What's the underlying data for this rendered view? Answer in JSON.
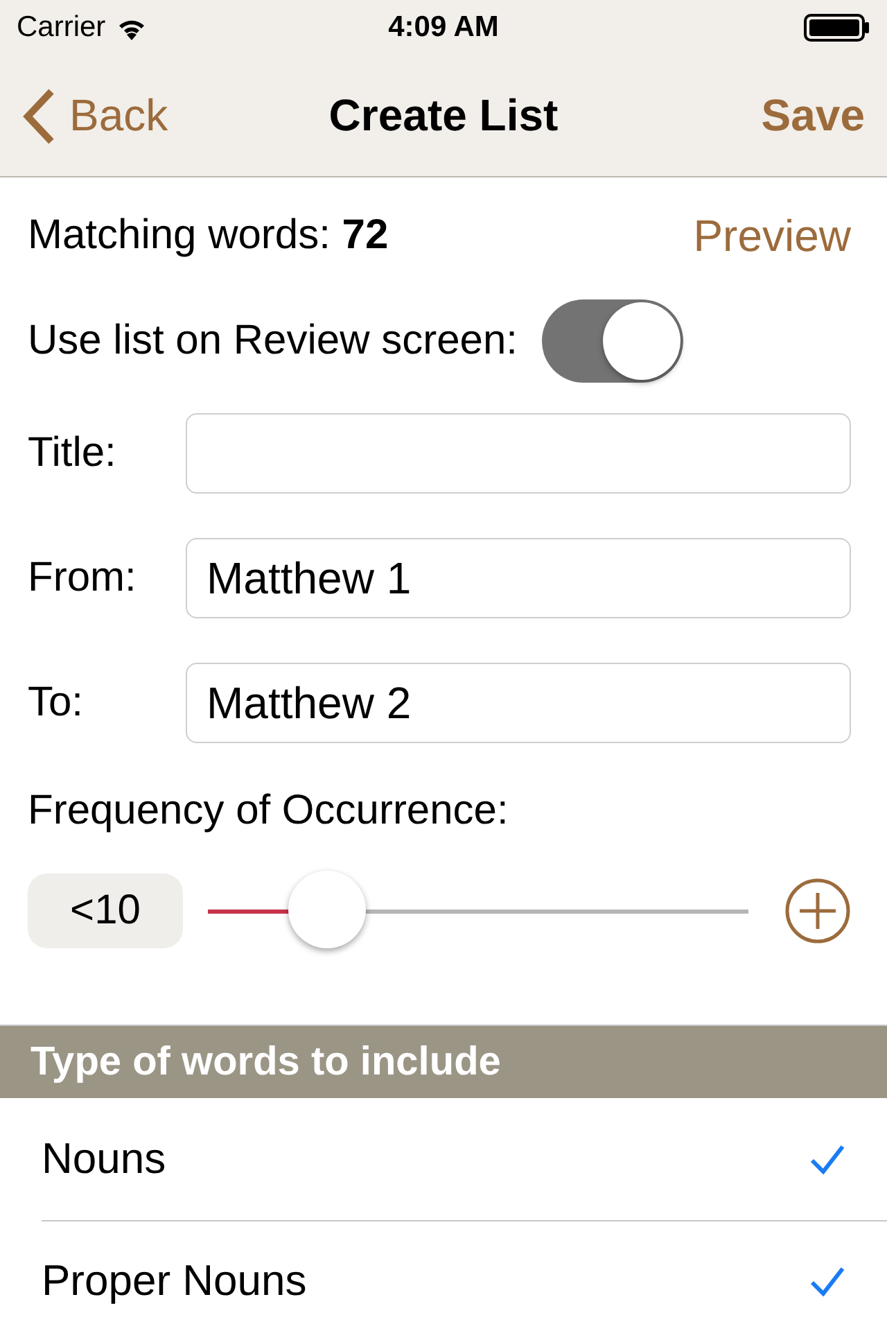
{
  "status_bar": {
    "carrier": "Carrier",
    "time": "4:09 AM"
  },
  "nav": {
    "back": "Back",
    "title": "Create List",
    "save": "Save"
  },
  "matching": {
    "text": "Matching words: **72**",
    "preview": "Preview"
  },
  "review_toggle": {
    "label": "Use list on Review screen:",
    "on": true
  },
  "fields": [
    {
      "label": "Title:"
    },
    {
      "label": "From:",
      "value": "Matthew 1"
    },
    {
      "label": "To:",
      "value": "Matthew 2"
    }
  ],
  "frequency": {
    "label": "Frequency of Occurrence:",
    "reading": "<10",
    "level": 0.22
  },
  "word_types": {
    "header": "Type of words to include",
    "items": [
      {
        "label": "Nouns",
        "checked": true
      },
      {
        "label": "Proper Nouns",
        "checked": true
      }
    ]
  }
}
